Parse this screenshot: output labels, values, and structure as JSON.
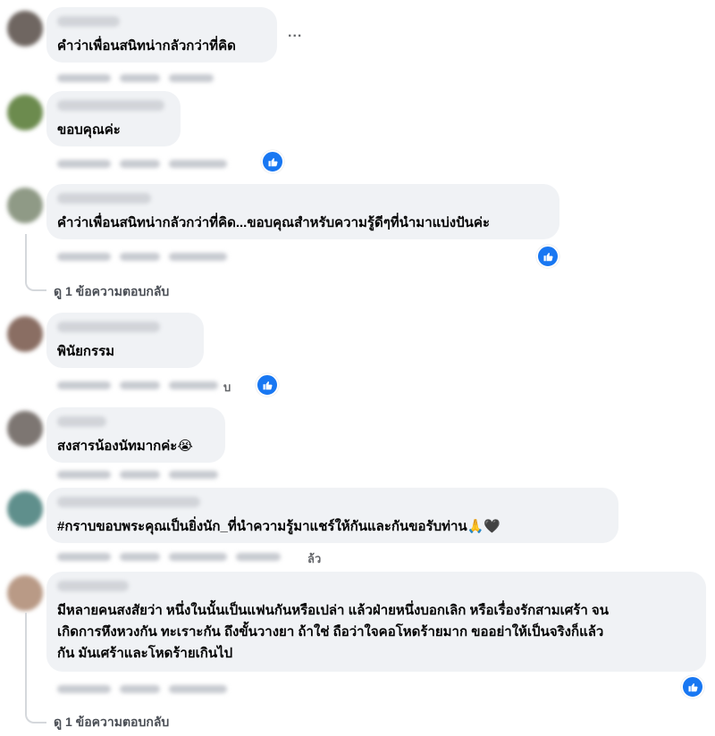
{
  "comments": [
    {
      "text": "คำว่าเพื่อนสนิทน่ากลัวกว่าที่คิด"
    },
    {
      "text": "ขอบคุณค่ะ"
    },
    {
      "text": "คำว่าเพื่อนสนิทน่ากลัวกว่าที่คิด...ขอบคุณสำหรับความรู้ดีๆที่นำมาแบ่งปันค่ะ"
    },
    {
      "text": "พินัยกรรม",
      "meta_tail": "บ"
    },
    {
      "text": "สงสารน้องนัทมากค่ะ",
      "emoji": "😭"
    },
    {
      "text": "#กราบขอบพระคุณเป็นยิ่งนัก_ที่นำความรู้มาแชร์ให้กันและกันขอรับท่าน",
      "emoji": "🙏🖤",
      "meta_tail": "ล้ว"
    },
    {
      "lines": [
        "มีหลายคนสงสัยว่า หนึ่งในนั้นเป็นแฟนกันหรือเปล่า แล้วฝ่ายหนึ่งบอกเลิก หรือเรื่องรักสามเศร้า จน",
        "เกิดการหึงหวงกัน ทะเราะกัน ถึงขั้นวางยา ถ้าใช่ ถือว่าใจคอโหดร้ายมาก ขออย่าให้เป็นจริงก็แล้ว",
        "กัน มันเศร้าและโหดร้ายเกินไป"
      ]
    }
  ],
  "more_options": "...",
  "view_replies_1": "ดู 1 ข้อความตอบกลับ",
  "view_replies_2": "ดู 1 ข้อความตอบกลับ",
  "colors": {
    "like_blue": "#1877f2",
    "bubble_bg": "#f0f2f5"
  },
  "icons": {
    "like": "thumbs-up-icon",
    "options": "more-options-icon"
  }
}
